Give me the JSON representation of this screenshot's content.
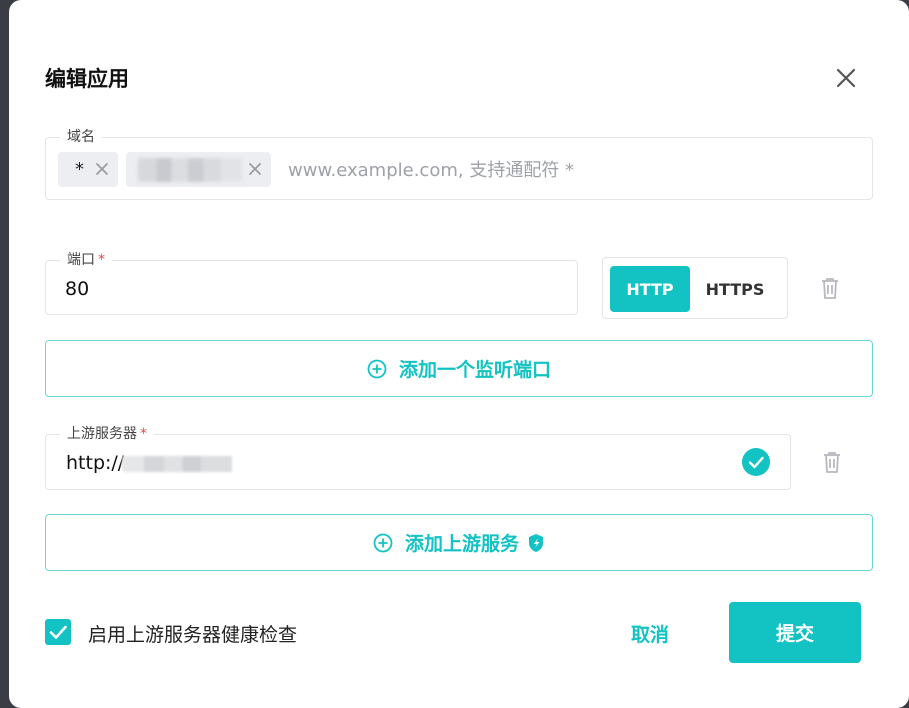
{
  "dialog": {
    "title": "编辑应用",
    "close_icon": "close-icon"
  },
  "domain": {
    "label": "域名",
    "chips": [
      {
        "text": "*"
      },
      {
        "text": ""
      }
    ],
    "placeholder": "www.example.com, 支持通配符 *"
  },
  "port": {
    "label": "端口",
    "required_mark": "*",
    "value": "80",
    "protocols": [
      "HTTP",
      "HTTPS"
    ],
    "selected_protocol": "HTTP",
    "delete_icon": "trash-icon"
  },
  "add_port_button": {
    "label": "添加一个监听端口",
    "icon": "plus-circle-icon"
  },
  "upstream": {
    "label": "上游服务器",
    "required_mark": "*",
    "value_prefix": "http://",
    "status_icon": "check-circle-icon",
    "delete_icon": "trash-icon"
  },
  "add_upstream_button": {
    "label": "添加上游服务",
    "icon": "plus-circle-icon",
    "badge_icon": "badge-icon"
  },
  "footer": {
    "health_check_label": "启用上游服务器健康检查",
    "health_check_checked": true,
    "cancel_label": "取消",
    "submit_label": "提交"
  },
  "colors": {
    "accent": "#13c2c2",
    "backdrop": "#3a3d44"
  }
}
